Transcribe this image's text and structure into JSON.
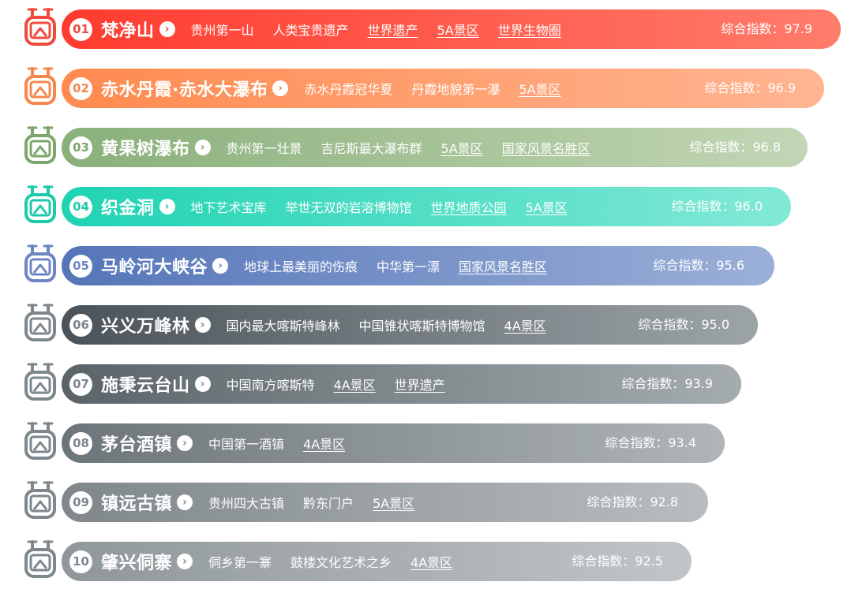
{
  "score_label": "综合指数：",
  "items": [
    {
      "rank": "01",
      "name": "梵净山",
      "tags": [
        {
          "text": "贵州第一山",
          "link": false
        },
        {
          "text": "人类宝贵遗产",
          "link": false
        },
        {
          "text": "世界遗产",
          "link": true
        },
        {
          "text": "5A景区",
          "link": true
        },
        {
          "text": "世界生物圈",
          "link": true
        }
      ],
      "score": "97.9",
      "color_start": "#ff3b2f",
      "color_end": "#ff7c6b",
      "icon_color": "#f04a3c"
    },
    {
      "rank": "02",
      "name": "赤水丹霞·赤水大瀑布",
      "tags": [
        {
          "text": "赤水丹霞冠华夏",
          "link": false
        },
        {
          "text": "丹霞地貌第一瀑",
          "link": false
        },
        {
          "text": "5A景区",
          "link": true
        }
      ],
      "score": "96.9",
      "color_start": "#ff8a4f",
      "color_end": "#ffb592",
      "icon_color": "#f5874d"
    },
    {
      "rank": "03",
      "name": "黄果树瀑布",
      "tags": [
        {
          "text": "贵州第一壮景",
          "link": false
        },
        {
          "text": "吉尼斯最大瀑布群",
          "link": false
        },
        {
          "text": "5A景区",
          "link": true
        },
        {
          "text": "国家风景名胜区",
          "link": true
        }
      ],
      "score": "96.8",
      "color_start": "#8ab07a",
      "color_end": "#c2d6b5",
      "icon_color": "#7ea56b"
    },
    {
      "rank": "04",
      "name": "织金洞",
      "tags": [
        {
          "text": "地下艺术宝库",
          "link": false
        },
        {
          "text": "举世无双的岩溶博物馆",
          "link": false
        },
        {
          "text": "世界地质公园",
          "link": true
        },
        {
          "text": "5A景区",
          "link": true
        }
      ],
      "score": "96.0",
      "color_start": "#1fd3b3",
      "color_end": "#83e9d7",
      "icon_color": "#1fc9a9"
    },
    {
      "rank": "05",
      "name": "马岭河大峡谷",
      "tags": [
        {
          "text": "地球上最美丽的伤痕",
          "link": false
        },
        {
          "text": "中华第一漂",
          "link": false
        },
        {
          "text": "国家风景名胜区",
          "link": true
        }
      ],
      "score": "95.6",
      "color_start": "#5575b8",
      "color_end": "#9bb0d8",
      "icon_color": "#6e87c4"
    },
    {
      "rank": "06",
      "name": "兴义万峰林",
      "tags": [
        {
          "text": "国内最大喀斯特峰林",
          "link": false
        },
        {
          "text": "中国锥状喀斯特博物馆",
          "link": false
        },
        {
          "text": "4A景区",
          "link": true
        }
      ],
      "score": "95.0",
      "color_start": "#4a5359",
      "color_end": "#9ca4a8",
      "icon_color": "#7d878c"
    },
    {
      "rank": "07",
      "name": "施秉云台山",
      "tags": [
        {
          "text": "中国南方喀斯特",
          "link": false
        },
        {
          "text": "4A景区",
          "link": true
        },
        {
          "text": "世界遗产",
          "link": true
        }
      ],
      "score": "93.9",
      "color_start": "#5a6468",
      "color_end": "#a5acaf",
      "icon_color": "#7d878c"
    },
    {
      "rank": "08",
      "name": "茅台酒镇",
      "tags": [
        {
          "text": "中国第一酒镇",
          "link": false
        },
        {
          "text": "4A景区",
          "link": true
        }
      ],
      "score": "93.4",
      "color_start": "#6c7579",
      "color_end": "#afb5b8",
      "icon_color": "#7d878c"
    },
    {
      "rank": "09",
      "name": "镇远古镇",
      "tags": [
        {
          "text": "贵州四大古镇",
          "link": false
        },
        {
          "text": "黔东门户",
          "link": false
        },
        {
          "text": "5A景区",
          "link": true
        }
      ],
      "score": "92.8",
      "color_start": "#7f878a",
      "color_end": "#b8bdbf",
      "icon_color": "#7d878c"
    },
    {
      "rank": "10",
      "name": "肇兴侗寨",
      "tags": [
        {
          "text": "侗乡第一寨",
          "link": false
        },
        {
          "text": "鼓楼文化艺术之乡",
          "link": false
        },
        {
          "text": "4A景区",
          "link": true
        }
      ],
      "score": "92.5",
      "color_start": "#8f979a",
      "color_end": "#c1c5c7",
      "icon_color": "#7d878c"
    }
  ]
}
